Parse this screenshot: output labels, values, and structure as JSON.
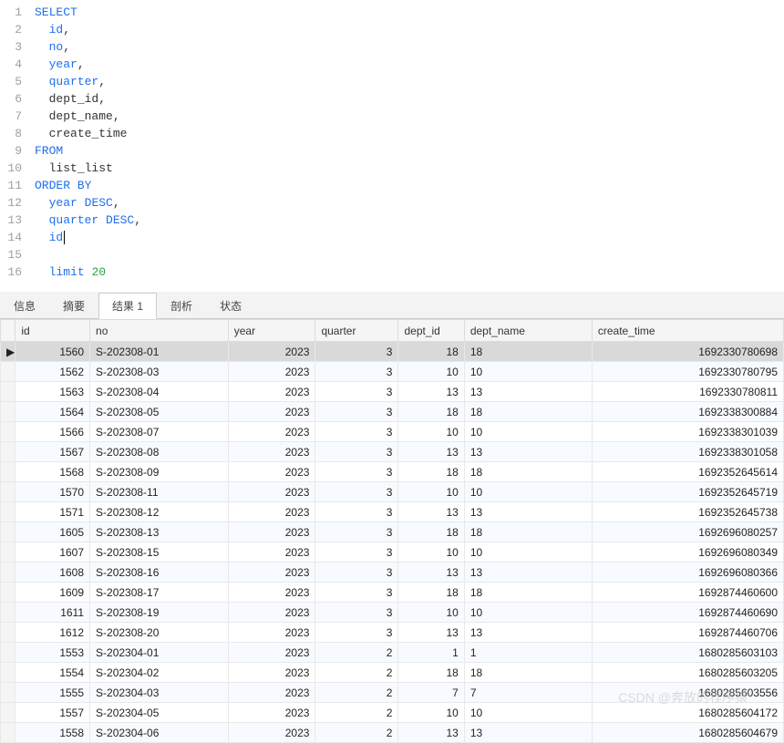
{
  "editor": {
    "lines": [
      {
        "n": 1,
        "tokens": [
          {
            "t": "SELECT",
            "c": "kw"
          }
        ]
      },
      {
        "n": 2,
        "tokens": [
          {
            "t": "  ",
            "c": ""
          },
          {
            "t": "id",
            "c": "ident"
          },
          {
            "t": ",",
            "c": "dark"
          }
        ]
      },
      {
        "n": 3,
        "tokens": [
          {
            "t": "  ",
            "c": ""
          },
          {
            "t": "no",
            "c": "ident"
          },
          {
            "t": ",",
            "c": "dark"
          }
        ]
      },
      {
        "n": 4,
        "tokens": [
          {
            "t": "  ",
            "c": ""
          },
          {
            "t": "year",
            "c": "ident"
          },
          {
            "t": ",",
            "c": "dark"
          }
        ]
      },
      {
        "n": 5,
        "tokens": [
          {
            "t": "  ",
            "c": ""
          },
          {
            "t": "quarter",
            "c": "ident"
          },
          {
            "t": ",",
            "c": "dark"
          }
        ]
      },
      {
        "n": 6,
        "tokens": [
          {
            "t": "  ",
            "c": ""
          },
          {
            "t": "dept_id,",
            "c": "dark"
          }
        ]
      },
      {
        "n": 7,
        "tokens": [
          {
            "t": "  ",
            "c": ""
          },
          {
            "t": "dept_name,",
            "c": "dark"
          }
        ]
      },
      {
        "n": 8,
        "tokens": [
          {
            "t": "  ",
            "c": ""
          },
          {
            "t": "create_time",
            "c": "dark"
          }
        ]
      },
      {
        "n": 9,
        "tokens": [
          {
            "t": "FROM",
            "c": "kw"
          }
        ]
      },
      {
        "n": 10,
        "tokens": [
          {
            "t": "  ",
            "c": ""
          },
          {
            "t": "list_list",
            "c": "dark"
          }
        ]
      },
      {
        "n": 11,
        "tokens": [
          {
            "t": "ORDER BY",
            "c": "kw"
          }
        ]
      },
      {
        "n": 12,
        "tokens": [
          {
            "t": "  ",
            "c": ""
          },
          {
            "t": "year",
            "c": "ident"
          },
          {
            "t": " ",
            "c": ""
          },
          {
            "t": "DESC",
            "c": "kw"
          },
          {
            "t": ",",
            "c": "dark"
          }
        ]
      },
      {
        "n": 13,
        "tokens": [
          {
            "t": "  ",
            "c": ""
          },
          {
            "t": "quarter",
            "c": "ident"
          },
          {
            "t": " ",
            "c": ""
          },
          {
            "t": "DESC",
            "c": "kw"
          },
          {
            "t": ",",
            "c": "dark"
          }
        ]
      },
      {
        "n": 14,
        "tokens": [
          {
            "t": "  ",
            "c": ""
          },
          {
            "t": "id",
            "c": "ident"
          },
          {
            "t": "|",
            "c": "dark cursor"
          }
        ]
      },
      {
        "n": 15,
        "tokens": []
      },
      {
        "n": 16,
        "tokens": [
          {
            "t": "  ",
            "c": ""
          },
          {
            "t": "limit",
            "c": "kw"
          },
          {
            "t": " ",
            "c": ""
          },
          {
            "t": "20",
            "c": "num"
          }
        ]
      }
    ]
  },
  "tabs": {
    "items": [
      "信息",
      "摘要",
      "结果 1",
      "剖析",
      "状态"
    ],
    "active_index": 2
  },
  "grid": {
    "columns": [
      "id",
      "no",
      "year",
      "quarter",
      "dept_id",
      "dept_name",
      "create_time"
    ],
    "selected_row": 0,
    "rows": [
      {
        "id": 1560,
        "no": "S-202308-01",
        "year": 2023,
        "quarter": 3,
        "dept_id": 18,
        "dept_name": "18",
        "create_time": 1692330780698
      },
      {
        "id": 1562,
        "no": "S-202308-03",
        "year": 2023,
        "quarter": 3,
        "dept_id": 10,
        "dept_name": "10",
        "create_time": 1692330780795
      },
      {
        "id": 1563,
        "no": "S-202308-04",
        "year": 2023,
        "quarter": 3,
        "dept_id": 13,
        "dept_name": "13",
        "create_time": 1692330780811
      },
      {
        "id": 1564,
        "no": "S-202308-05",
        "year": 2023,
        "quarter": 3,
        "dept_id": 18,
        "dept_name": "18",
        "create_time": 1692338300884
      },
      {
        "id": 1566,
        "no": "S-202308-07",
        "year": 2023,
        "quarter": 3,
        "dept_id": 10,
        "dept_name": "10",
        "create_time": 1692338301039
      },
      {
        "id": 1567,
        "no": "S-202308-08",
        "year": 2023,
        "quarter": 3,
        "dept_id": 13,
        "dept_name": "13",
        "create_time": 1692338301058
      },
      {
        "id": 1568,
        "no": "S-202308-09",
        "year": 2023,
        "quarter": 3,
        "dept_id": 18,
        "dept_name": "18",
        "create_time": 1692352645614
      },
      {
        "id": 1570,
        "no": "S-202308-11",
        "year": 2023,
        "quarter": 3,
        "dept_id": 10,
        "dept_name": "10",
        "create_time": 1692352645719
      },
      {
        "id": 1571,
        "no": "S-202308-12",
        "year": 2023,
        "quarter": 3,
        "dept_id": 13,
        "dept_name": "13",
        "create_time": 1692352645738
      },
      {
        "id": 1605,
        "no": "S-202308-13",
        "year": 2023,
        "quarter": 3,
        "dept_id": 18,
        "dept_name": "18",
        "create_time": 1692696080257
      },
      {
        "id": 1607,
        "no": "S-202308-15",
        "year": 2023,
        "quarter": 3,
        "dept_id": 10,
        "dept_name": "10",
        "create_time": 1692696080349
      },
      {
        "id": 1608,
        "no": "S-202308-16",
        "year": 2023,
        "quarter": 3,
        "dept_id": 13,
        "dept_name": "13",
        "create_time": 1692696080366
      },
      {
        "id": 1609,
        "no": "S-202308-17",
        "year": 2023,
        "quarter": 3,
        "dept_id": 18,
        "dept_name": "18",
        "create_time": 1692874460600
      },
      {
        "id": 1611,
        "no": "S-202308-19",
        "year": 2023,
        "quarter": 3,
        "dept_id": 10,
        "dept_name": "10",
        "create_time": 1692874460690
      },
      {
        "id": 1612,
        "no": "S-202308-20",
        "year": 2023,
        "quarter": 3,
        "dept_id": 13,
        "dept_name": "13",
        "create_time": 1692874460706
      },
      {
        "id": 1553,
        "no": "S-202304-01",
        "year": 2023,
        "quarter": 2,
        "dept_id": 1,
        "dept_name": "1",
        "create_time": 1680285603103
      },
      {
        "id": 1554,
        "no": "S-202304-02",
        "year": 2023,
        "quarter": 2,
        "dept_id": 18,
        "dept_name": "18",
        "create_time": 1680285603205
      },
      {
        "id": 1555,
        "no": "S-202304-03",
        "year": 2023,
        "quarter": 2,
        "dept_id": 7,
        "dept_name": "7",
        "create_time": 1680285603556
      },
      {
        "id": 1557,
        "no": "S-202304-05",
        "year": 2023,
        "quarter": 2,
        "dept_id": 10,
        "dept_name": "10",
        "create_time": 1680285604172
      },
      {
        "id": 1558,
        "no": "S-202304-06",
        "year": 2023,
        "quarter": 2,
        "dept_id": 13,
        "dept_name": "13",
        "create_time": 1680285604679
      }
    ]
  },
  "watermark": "CSDN @奔放的程序猿"
}
